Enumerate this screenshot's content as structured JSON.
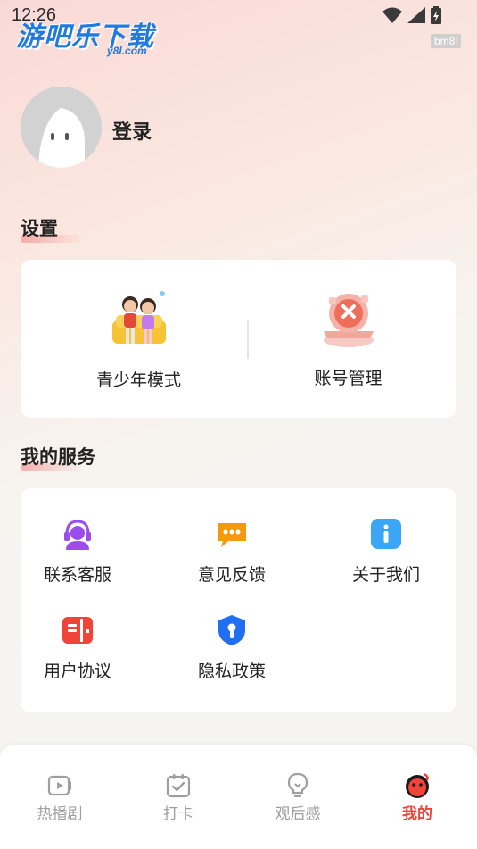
{
  "status_bar": {
    "time": "12:26"
  },
  "watermark": {
    "text": "游吧乐下载",
    "sub": "y8l.com",
    "badge": "bm8l"
  },
  "profile": {
    "login_label": "登录"
  },
  "settings": {
    "title": "设置",
    "items": [
      {
        "label": "青少年模式",
        "icon": "teen-mode-icon"
      },
      {
        "label": "账号管理",
        "icon": "account-manage-icon"
      }
    ]
  },
  "services": {
    "title": "我的服务",
    "items": [
      {
        "label": "联系客服",
        "icon": "customer-service-icon",
        "color": "#9b4dea"
      },
      {
        "label": "意见反馈",
        "icon": "feedback-icon",
        "color": "#f59a0b"
      },
      {
        "label": "关于我们",
        "icon": "info-icon",
        "color": "#3aa6f5"
      },
      {
        "label": "用户协议",
        "icon": "agreement-icon",
        "color": "#f0443a"
      },
      {
        "label": "隐私政策",
        "icon": "privacy-shield-icon",
        "color": "#1f6ff0"
      }
    ]
  },
  "tabbar": {
    "items": [
      {
        "label": "热播剧",
        "icon": "video-icon"
      },
      {
        "label": "打卡",
        "icon": "checkin-icon"
      },
      {
        "label": "观后感",
        "icon": "lightbulb-icon"
      },
      {
        "label": "我的",
        "icon": "mine-icon"
      }
    ],
    "active_color": "#f0443a"
  }
}
